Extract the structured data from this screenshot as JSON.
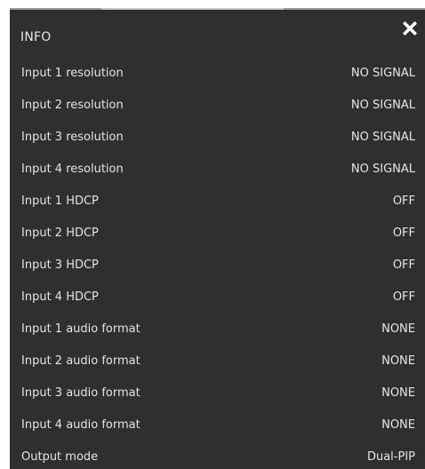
{
  "panel": {
    "title": "INFO"
  },
  "icons": {
    "close": "close-icon"
  },
  "rows": [
    {
      "label": "Input 1 resolution",
      "value": "NO SIGNAL"
    },
    {
      "label": "Input 2 resolution",
      "value": "NO SIGNAL"
    },
    {
      "label": "Input 3 resolution",
      "value": "NO SIGNAL"
    },
    {
      "label": "Input 4 resolution",
      "value": "NO SIGNAL"
    },
    {
      "label": "Input 1 HDCP",
      "value": "OFF"
    },
    {
      "label": "Input 2 HDCP",
      "value": "OFF"
    },
    {
      "label": "Input 3 HDCP",
      "value": "OFF"
    },
    {
      "label": "Input 4 HDCP",
      "value": "OFF"
    },
    {
      "label": "Input 1 audio format",
      "value": "NONE"
    },
    {
      "label": "Input 2 audio format",
      "value": "NONE"
    },
    {
      "label": "Input 3 audio format",
      "value": "NONE"
    },
    {
      "label": "Input 4 audio format",
      "value": "NONE"
    },
    {
      "label": "Output mode",
      "value": "Dual-PIP"
    }
  ],
  "colors": {
    "panel_background": "#2f2f2f",
    "text": "#e4e4e4",
    "close_icon": "#ffffff"
  }
}
